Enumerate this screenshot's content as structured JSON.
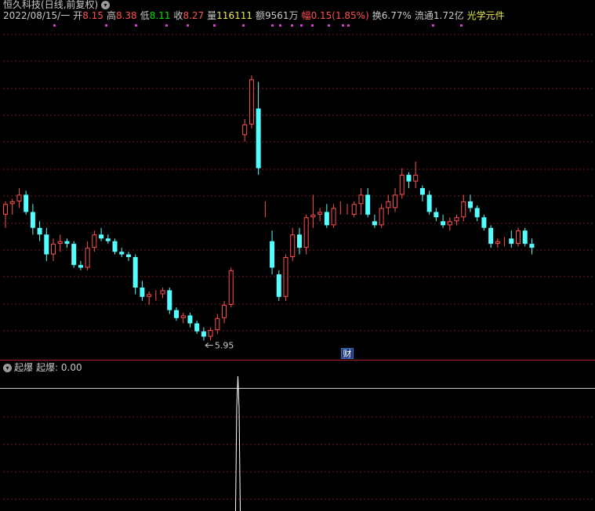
{
  "title": {
    "stock_name": "恒久科技",
    "period": "(日线,前复权)",
    "colors": {
      "text": "#c8c8c8"
    }
  },
  "quote": {
    "date": "2022/08/15/一",
    "open_label": "开",
    "open": "8.15",
    "high_label": "高",
    "high": "8.38",
    "low_label": "低",
    "low": "8.11",
    "close_label": "收",
    "close": "8.27",
    "volume_label": "量",
    "volume": "116111",
    "amount_label": "额",
    "amount": "9561万",
    "change_label": "幅",
    "change": "0.15(1.85%)",
    "turnover_label": "换",
    "turnover": "6.77%",
    "float_label": "流通",
    "float": "1.72亿",
    "sector": "光学元件"
  },
  "markers": {
    "low_marker": "5.95",
    "finance_badge": "财"
  },
  "indicator": {
    "name": "起爆",
    "value_label": "起爆:",
    "value": "0.00"
  },
  "colors": {
    "up": "#ff5050",
    "down": "#54ffff",
    "grid": "#7a1a1a",
    "separator": "#b02020",
    "open": "#ff5050",
    "high": "#ff5050",
    "low": "#00e000",
    "close": "#ff5050",
    "volume": "#e8e850",
    "amount": "#c8c8c8",
    "change": "#ff5050",
    "sector": "#e8e850",
    "indicator_value": "#c8c8c8"
  },
  "chart_data": {
    "type": "candlestick",
    "series": [
      {
        "values": [
          [
            6.9,
            7.0,
            6.8,
            6.98
          ],
          [
            6.98,
            7.02,
            6.9,
            7.0
          ],
          [
            7.0,
            7.1,
            6.95,
            7.05
          ],
          [
            7.05,
            7.08,
            6.9,
            6.92
          ],
          [
            6.92,
            6.98,
            6.75,
            6.8
          ],
          [
            6.8,
            6.85,
            6.7,
            6.75
          ],
          [
            6.75,
            6.8,
            6.55,
            6.6
          ],
          [
            6.6,
            6.72,
            6.55,
            6.68
          ],
          [
            6.68,
            6.75,
            6.62,
            6.7
          ],
          [
            6.7,
            6.72,
            6.65,
            6.68
          ],
          [
            6.68,
            6.7,
            6.5,
            6.52
          ],
          [
            6.52,
            6.55,
            6.48,
            6.5
          ],
          [
            6.5,
            6.7,
            6.48,
            6.65
          ],
          [
            6.65,
            6.78,
            6.62,
            6.75
          ],
          [
            6.75,
            6.8,
            6.7,
            6.72
          ],
          [
            6.72,
            6.75,
            6.68,
            6.7
          ],
          [
            6.7,
            6.72,
            6.6,
            6.62
          ],
          [
            6.62,
            6.65,
            6.58,
            6.6
          ],
          [
            6.6,
            6.62,
            6.55,
            6.58
          ],
          [
            6.58,
            6.6,
            6.3,
            6.35
          ],
          [
            6.35,
            6.4,
            6.25,
            6.28
          ],
          [
            6.28,
            6.32,
            6.22,
            6.3
          ],
          [
            6.3,
            6.33,
            6.25,
            6.3
          ],
          [
            6.3,
            6.35,
            6.27,
            6.33
          ],
          [
            6.33,
            6.35,
            6.15,
            6.18
          ],
          [
            6.18,
            6.2,
            6.1,
            6.12
          ],
          [
            6.12,
            6.16,
            6.08,
            6.14
          ],
          [
            6.14,
            6.16,
            6.05,
            6.08
          ],
          [
            6.08,
            6.1,
            6.0,
            6.02
          ],
          [
            6.02,
            6.05,
            5.95,
            5.98
          ],
          [
            5.98,
            6.05,
            5.95,
            6.03
          ],
          [
            6.03,
            6.15,
            6.0,
            6.12
          ],
          [
            6.12,
            6.25,
            6.08,
            6.22
          ],
          [
            6.22,
            6.5,
            6.2,
            6.48
          ],
          [
            6.92,
            6.92,
            6.92,
            6.92
          ],
          [
            7.5,
            7.62,
            7.45,
            7.58
          ],
          [
            7.58,
            7.95,
            7.55,
            7.92
          ],
          [
            7.7,
            7.9,
            7.2,
            7.25
          ],
          [
            6.9,
            7.0,
            6.88,
            6.9
          ],
          [
            6.7,
            6.78,
            6.45,
            6.5
          ],
          [
            6.45,
            6.48,
            6.25,
            6.28
          ],
          [
            6.28,
            6.6,
            6.25,
            6.58
          ],
          [
            6.58,
            6.8,
            6.55,
            6.75
          ],
          [
            6.75,
            6.8,
            6.6,
            6.65
          ],
          [
            6.65,
            6.9,
            6.6,
            6.88
          ],
          [
            6.88,
            7.05,
            6.8,
            6.9
          ],
          [
            6.9,
            6.95,
            6.85,
            6.92
          ],
          [
            6.92,
            6.98,
            6.8,
            6.82
          ],
          [
            6.82,
            6.98,
            6.8,
            6.95
          ],
          [
            6.95,
            7.0,
            6.9,
            6.95
          ],
          [
            6.95,
            6.98,
            6.9,
            6.95
          ],
          [
            6.9,
            7.0,
            6.88,
            6.98
          ],
          [
            6.98,
            7.1,
            6.9,
            7.05
          ],
          [
            7.05,
            7.1,
            6.88,
            6.9
          ],
          [
            6.85,
            6.9,
            6.8,
            6.82
          ],
          [
            6.82,
            6.98,
            6.8,
            6.95
          ],
          [
            6.95,
            7.05,
            6.9,
            7.0
          ],
          [
            6.95,
            7.1,
            6.92,
            7.05
          ],
          [
            7.05,
            7.25,
            7.02,
            7.2
          ],
          [
            7.2,
            7.22,
            7.1,
            7.15
          ],
          [
            7.15,
            7.3,
            7.1,
            7.2
          ],
          [
            7.1,
            7.12,
            7.0,
            7.05
          ],
          [
            7.05,
            7.08,
            6.9,
            6.92
          ],
          [
            6.92,
            6.95,
            6.85,
            6.88
          ],
          [
            6.85,
            6.9,
            6.8,
            6.82
          ],
          [
            6.82,
            6.88,
            6.78,
            6.85
          ],
          [
            6.85,
            6.9,
            6.82,
            6.88
          ],
          [
            6.88,
            7.05,
            6.85,
            7.0
          ],
          [
            7.0,
            7.05,
            6.92,
            6.95
          ],
          [
            6.95,
            6.97,
            6.85,
            6.88
          ],
          [
            6.88,
            6.9,
            6.78,
            6.8
          ],
          [
            6.8,
            6.82,
            6.65,
            6.68
          ],
          [
            6.68,
            6.72,
            6.65,
            6.7
          ],
          [
            6.7,
            6.73,
            6.66,
            6.7
          ],
          [
            6.72,
            6.78,
            6.65,
            6.68
          ],
          [
            6.68,
            6.8,
            6.66,
            6.78
          ],
          [
            6.78,
            6.8,
            6.66,
            6.68
          ],
          [
            6.68,
            6.72,
            6.6,
            6.65
          ]
        ]
      }
    ],
    "indicator_series": [
      {
        "values": [
          0,
          0,
          0,
          0,
          0,
          0,
          0,
          0,
          0,
          0,
          0,
          0,
          0,
          0,
          0,
          0,
          0,
          0,
          0,
          0,
          0,
          0,
          0,
          0,
          0,
          0,
          0,
          0,
          0,
          0,
          0,
          0,
          0,
          0,
          100,
          0,
          0,
          0,
          0,
          0,
          0,
          0,
          0,
          0,
          0,
          0,
          0,
          0,
          0,
          0,
          0,
          0,
          0,
          0,
          0,
          0,
          0,
          0,
          0,
          0,
          0,
          0,
          0,
          0,
          0,
          0,
          0,
          0,
          0,
          0,
          0,
          0,
          0,
          0,
          0,
          0,
          0,
          0
        ]
      }
    ],
    "price_range": [
      5.8,
      8.4
    ],
    "grid": true
  }
}
